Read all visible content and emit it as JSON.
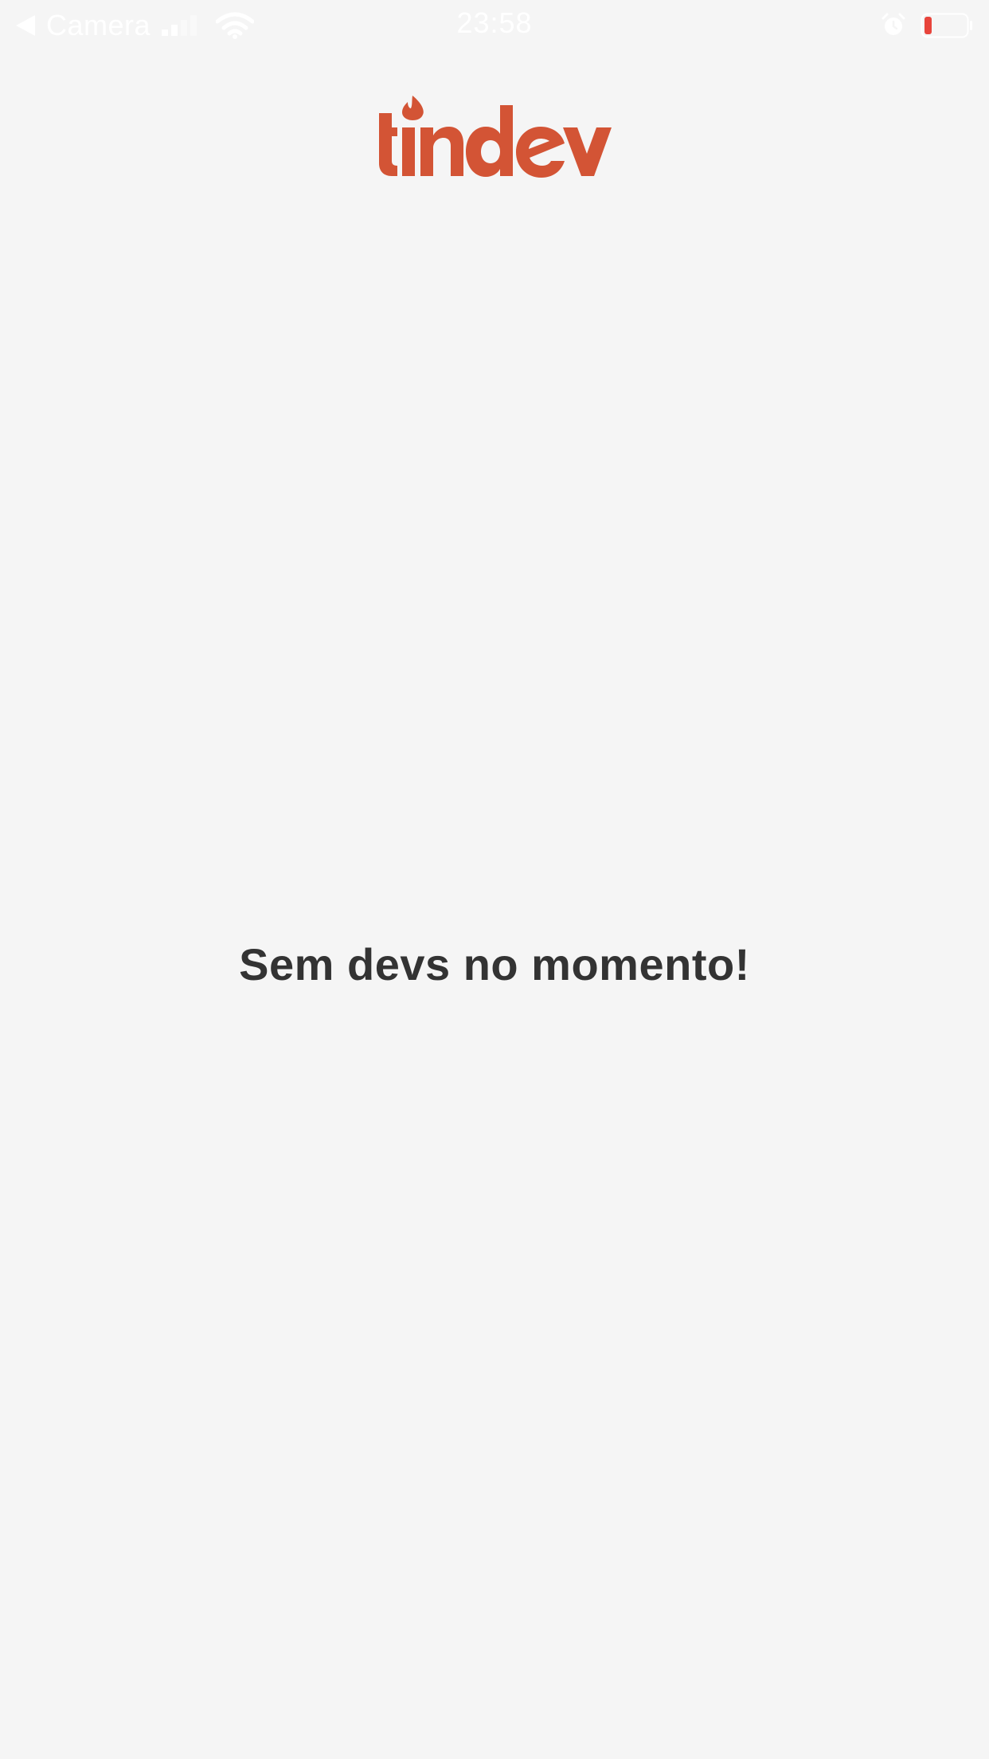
{
  "status_bar": {
    "back_app": "Camera",
    "time": "23:58",
    "icons": [
      "back-arrow-icon",
      "signal-icon",
      "wifi-icon",
      "alarm-icon",
      "battery-icon"
    ],
    "battery_color": "#e8453c"
  },
  "header": {
    "logo_text": "tindev",
    "brand_color": "#d35435"
  },
  "main": {
    "empty_message": "Sem devs no momento!"
  }
}
